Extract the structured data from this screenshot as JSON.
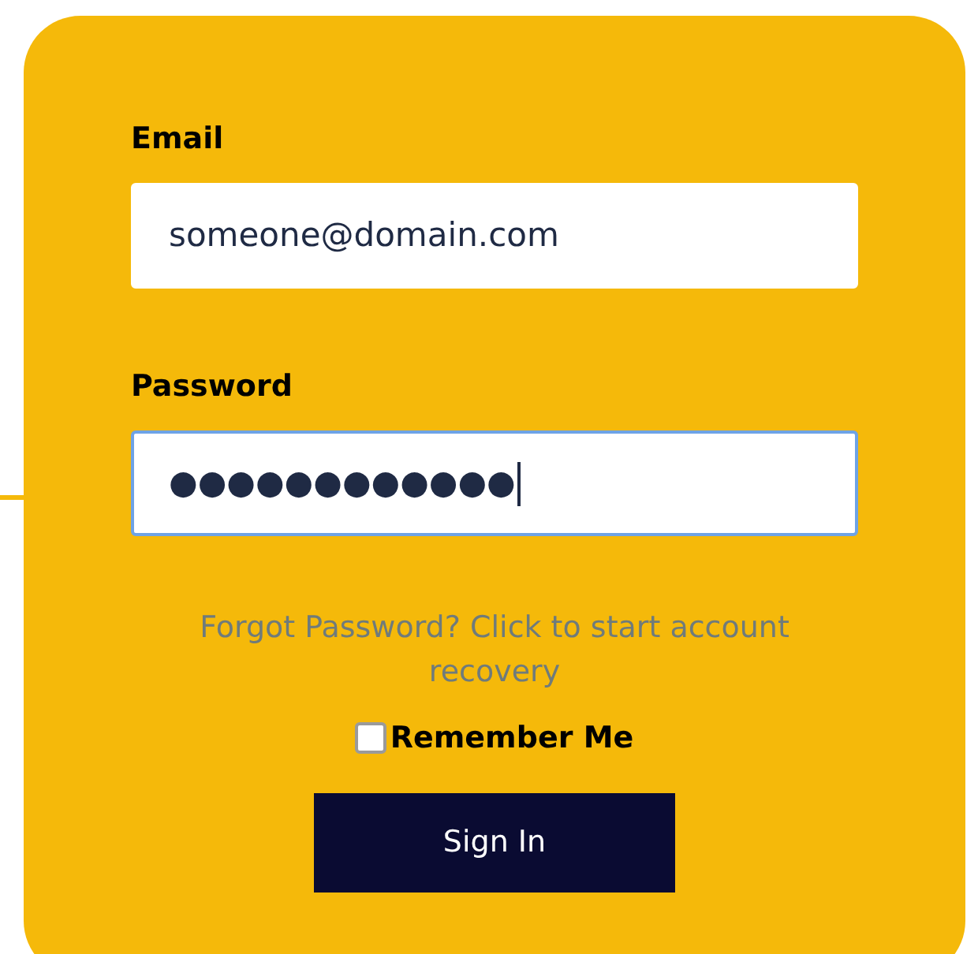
{
  "form": {
    "fields": [
      {
        "label": "Email",
        "value": "someone@domain.com",
        "focused": false
      },
      {
        "label": "Password",
        "value": "●●●●●●●●●●●●",
        "focused": true
      }
    ],
    "forgot_link": "Forgot Password? Click to start account recovery",
    "remember_me": {
      "label": "Remember Me",
      "checked": false
    },
    "submit": "Sign In"
  }
}
